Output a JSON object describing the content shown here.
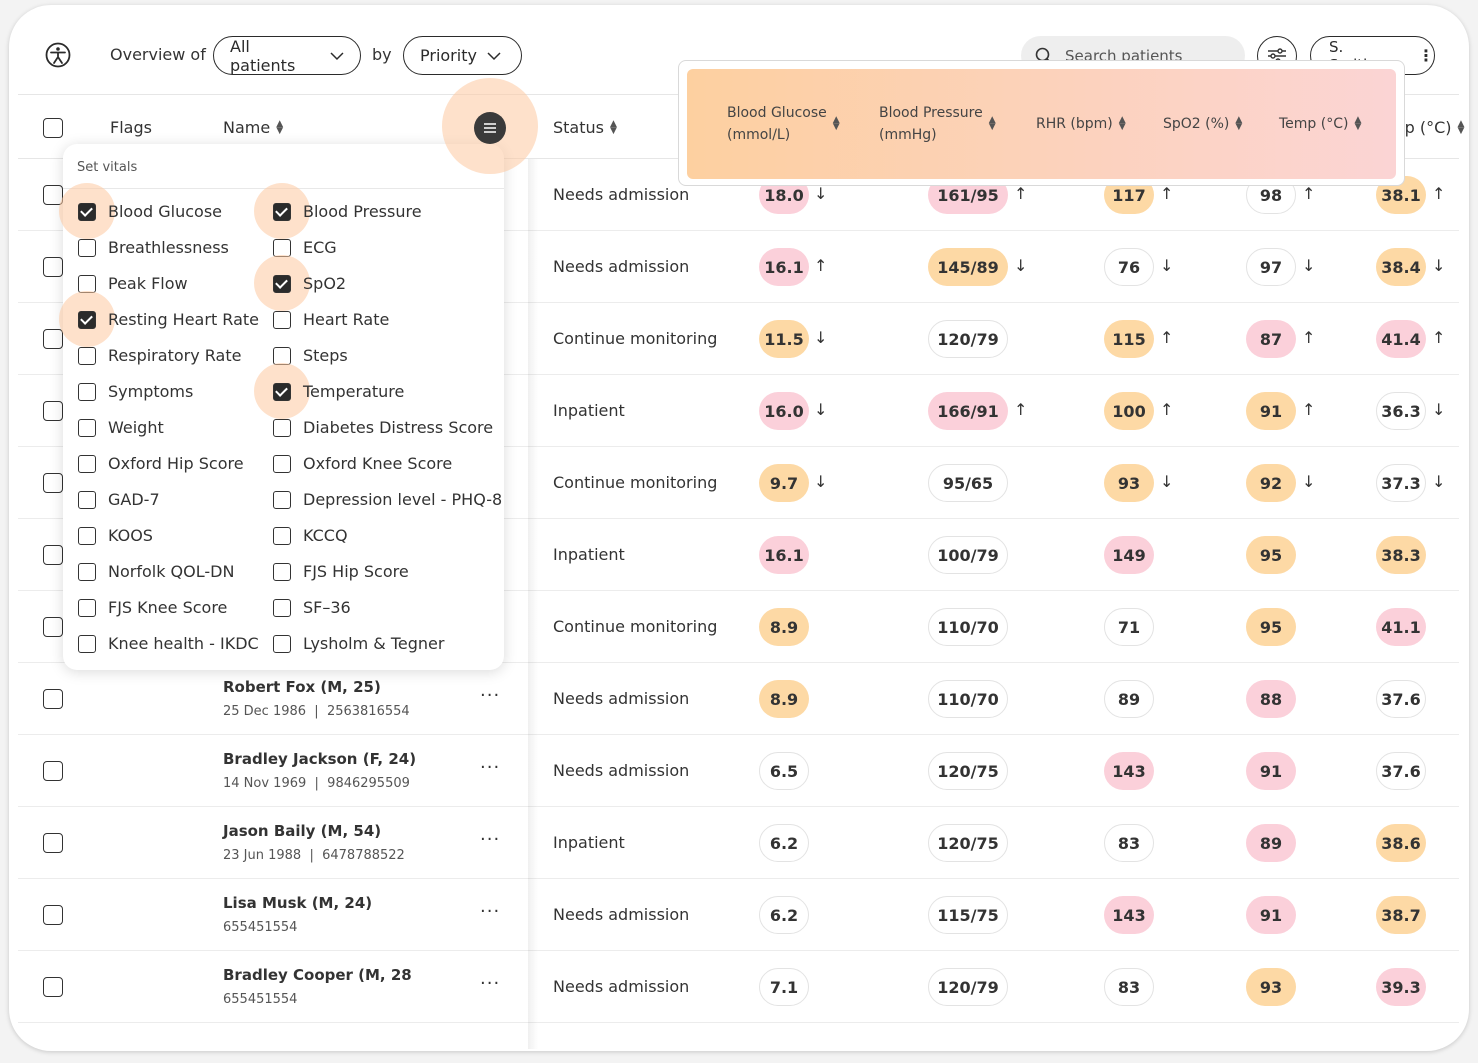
{
  "header": {
    "overview_label": "Overview of",
    "patients_select": "All patients",
    "by_label": "by",
    "sort_select": "Priority",
    "search_placeholder": "Search patients",
    "user_name": "S. Smith"
  },
  "columns": {
    "flags": "Flags",
    "name": "Name",
    "status": "Status",
    "temp_partial": "mp (°C)"
  },
  "highlight_columns": [
    {
      "line1": "Blood Glucose",
      "line2": "(mmol/L)"
    },
    {
      "line1": "Blood Pressure",
      "line2": "(mmHg)"
    },
    {
      "line1": "RHR (bpm)",
      "line2": ""
    },
    {
      "line1": "SpO2 (%)",
      "line2": ""
    },
    {
      "line1": "Temp (°C)",
      "line2": ""
    }
  ],
  "vitals_panel": {
    "title": "Set vitals",
    "options_left": [
      {
        "label": "Blood Glucose",
        "checked": true
      },
      {
        "label": "Breathlessness",
        "checked": false
      },
      {
        "label": "Peak Flow",
        "checked": false
      },
      {
        "label": "Resting Heart Rate",
        "checked": true
      },
      {
        "label": "Respiratory Rate",
        "checked": false
      },
      {
        "label": "Symptoms",
        "checked": false
      },
      {
        "label": "Weight",
        "checked": false
      },
      {
        "label": "Oxford Hip Score",
        "checked": false
      },
      {
        "label": "GAD-7",
        "checked": false
      },
      {
        "label": "KOOS",
        "checked": false
      },
      {
        "label": "Norfolk QOL-DN",
        "checked": false
      },
      {
        "label": "FJS Knee Score",
        "checked": false
      },
      {
        "label": "Knee health - IKDC",
        "checked": false
      }
    ],
    "options_right": [
      {
        "label": "Blood Pressure",
        "checked": true
      },
      {
        "label": "ECG",
        "checked": false
      },
      {
        "label": "SpO2",
        "checked": true
      },
      {
        "label": "Heart Rate",
        "checked": false
      },
      {
        "label": "Steps",
        "checked": false
      },
      {
        "label": "Temperature",
        "checked": true
      },
      {
        "label": "Diabetes Distress Score",
        "checked": false
      },
      {
        "label": "Oxford Knee Score",
        "checked": false
      },
      {
        "label": "Depression level - PHQ-8",
        "checked": false
      },
      {
        "label": "KCCQ",
        "checked": false
      },
      {
        "label": "FJS Hip Score",
        "checked": false
      },
      {
        "label": "SF–36",
        "checked": false
      },
      {
        "label": "Lysholm & Tegner",
        "checked": false
      }
    ]
  },
  "colors": {
    "pink": "#fbd0da",
    "orange": "#fdd9a5",
    "none": "#ffffff"
  },
  "rows": [
    {
      "name": "",
      "meta": "",
      "status": "Needs admission",
      "vitals": [
        {
          "v": "18.0",
          "c": "pink",
          "t": "down"
        },
        {
          "v": "161/95",
          "c": "pink",
          "t": "up"
        },
        {
          "v": "117",
          "c": "orange",
          "t": "up"
        },
        {
          "v": "98",
          "c": "none",
          "t": "up"
        },
        {
          "v": "38.1",
          "c": "orange",
          "t": "up"
        }
      ]
    },
    {
      "name": "",
      "meta": "",
      "status": "Needs admission",
      "vitals": [
        {
          "v": "16.1",
          "c": "pink",
          "t": "up"
        },
        {
          "v": "145/89",
          "c": "orange",
          "t": "down"
        },
        {
          "v": "76",
          "c": "none",
          "t": "down"
        },
        {
          "v": "97",
          "c": "none",
          "t": "down"
        },
        {
          "v": "38.4",
          "c": "orange",
          "t": "down"
        }
      ]
    },
    {
      "name": "",
      "meta": "",
      "status": "Continue monitoring",
      "vitals": [
        {
          "v": "11.5",
          "c": "orange",
          "t": "down"
        },
        {
          "v": "120/79",
          "c": "none",
          "t": ""
        },
        {
          "v": "115",
          "c": "orange",
          "t": "up"
        },
        {
          "v": "87",
          "c": "pink",
          "t": "up"
        },
        {
          "v": "41.4",
          "c": "pink",
          "t": "up"
        }
      ]
    },
    {
      "name": "",
      "meta": "",
      "status": "Inpatient",
      "vitals": [
        {
          "v": "16.0",
          "c": "pink",
          "t": "down"
        },
        {
          "v": "166/91",
          "c": "pink",
          "t": "up"
        },
        {
          "v": "100",
          "c": "orange",
          "t": "up"
        },
        {
          "v": "91",
          "c": "orange",
          "t": "up"
        },
        {
          "v": "36.3",
          "c": "none",
          "t": "down"
        }
      ]
    },
    {
      "name": "",
      "meta": "",
      "status": "Continue monitoring",
      "vitals": [
        {
          "v": "9.7",
          "c": "orange",
          "t": "down"
        },
        {
          "v": "95/65",
          "c": "none",
          "t": ""
        },
        {
          "v": "93",
          "c": "orange",
          "t": "down"
        },
        {
          "v": "92",
          "c": "orange",
          "t": "down"
        },
        {
          "v": "37.3",
          "c": "none",
          "t": "down"
        }
      ]
    },
    {
      "name": "",
      "meta": "",
      "status": "Inpatient",
      "vitals": [
        {
          "v": "16.1",
          "c": "pink",
          "t": ""
        },
        {
          "v": "100/79",
          "c": "none",
          "t": ""
        },
        {
          "v": "149",
          "c": "pink",
          "t": ""
        },
        {
          "v": "95",
          "c": "orange",
          "t": ""
        },
        {
          "v": "38.3",
          "c": "orange",
          "t": ""
        }
      ]
    },
    {
      "name": "",
      "meta": "",
      "status": "Continue monitoring",
      "vitals": [
        {
          "v": "8.9",
          "c": "orange",
          "t": ""
        },
        {
          "v": "110/70",
          "c": "none",
          "t": ""
        },
        {
          "v": "71",
          "c": "none",
          "t": ""
        },
        {
          "v": "95",
          "c": "orange",
          "t": ""
        },
        {
          "v": "41.1",
          "c": "pink",
          "t": ""
        }
      ]
    },
    {
      "name": "Robert Fox (M, 25)",
      "meta": "25 Dec 1986  |  2563816554",
      "status": "Needs admission",
      "vitals": [
        {
          "v": "8.9",
          "c": "orange",
          "t": ""
        },
        {
          "v": "110/70",
          "c": "none",
          "t": ""
        },
        {
          "v": "89",
          "c": "none",
          "t": ""
        },
        {
          "v": "88",
          "c": "pink",
          "t": ""
        },
        {
          "v": "37.6",
          "c": "none",
          "t": ""
        }
      ]
    },
    {
      "name": "Bradley Jackson (F, 24)",
      "meta": "14 Nov 1969  |  9846295509",
      "status": "Needs admission",
      "vitals": [
        {
          "v": "6.5",
          "c": "none",
          "t": ""
        },
        {
          "v": "120/75",
          "c": "none",
          "t": ""
        },
        {
          "v": "143",
          "c": "pink",
          "t": ""
        },
        {
          "v": "91",
          "c": "pink",
          "t": ""
        },
        {
          "v": "37.6",
          "c": "none",
          "t": ""
        }
      ]
    },
    {
      "name": "Jason Baily (M, 54)",
      "meta": "23 Jun 1988  |  6478788522",
      "status": "Inpatient",
      "vitals": [
        {
          "v": "6.2",
          "c": "none",
          "t": ""
        },
        {
          "v": "120/75",
          "c": "none",
          "t": ""
        },
        {
          "v": "83",
          "c": "none",
          "t": ""
        },
        {
          "v": "89",
          "c": "pink",
          "t": ""
        },
        {
          "v": "38.6",
          "c": "orange",
          "t": ""
        }
      ]
    },
    {
      "name": "Lisa Musk (M, 24)",
      "meta": "655451554",
      "status": "Needs admission",
      "vitals": [
        {
          "v": "6.2",
          "c": "none",
          "t": ""
        },
        {
          "v": "115/75",
          "c": "none",
          "t": ""
        },
        {
          "v": "143",
          "c": "pink",
          "t": ""
        },
        {
          "v": "91",
          "c": "pink",
          "t": ""
        },
        {
          "v": "38.7",
          "c": "orange",
          "t": ""
        }
      ]
    },
    {
      "name": "Bradley Cooper (M, 28",
      "meta": "655451554",
      "status": "Needs admission",
      "vitals": [
        {
          "v": "7.1",
          "c": "none",
          "t": ""
        },
        {
          "v": "120/79",
          "c": "none",
          "t": ""
        },
        {
          "v": "83",
          "c": "none",
          "t": ""
        },
        {
          "v": "93",
          "c": "orange",
          "t": ""
        },
        {
          "v": "39.3",
          "c": "pink",
          "t": ""
        }
      ]
    }
  ]
}
